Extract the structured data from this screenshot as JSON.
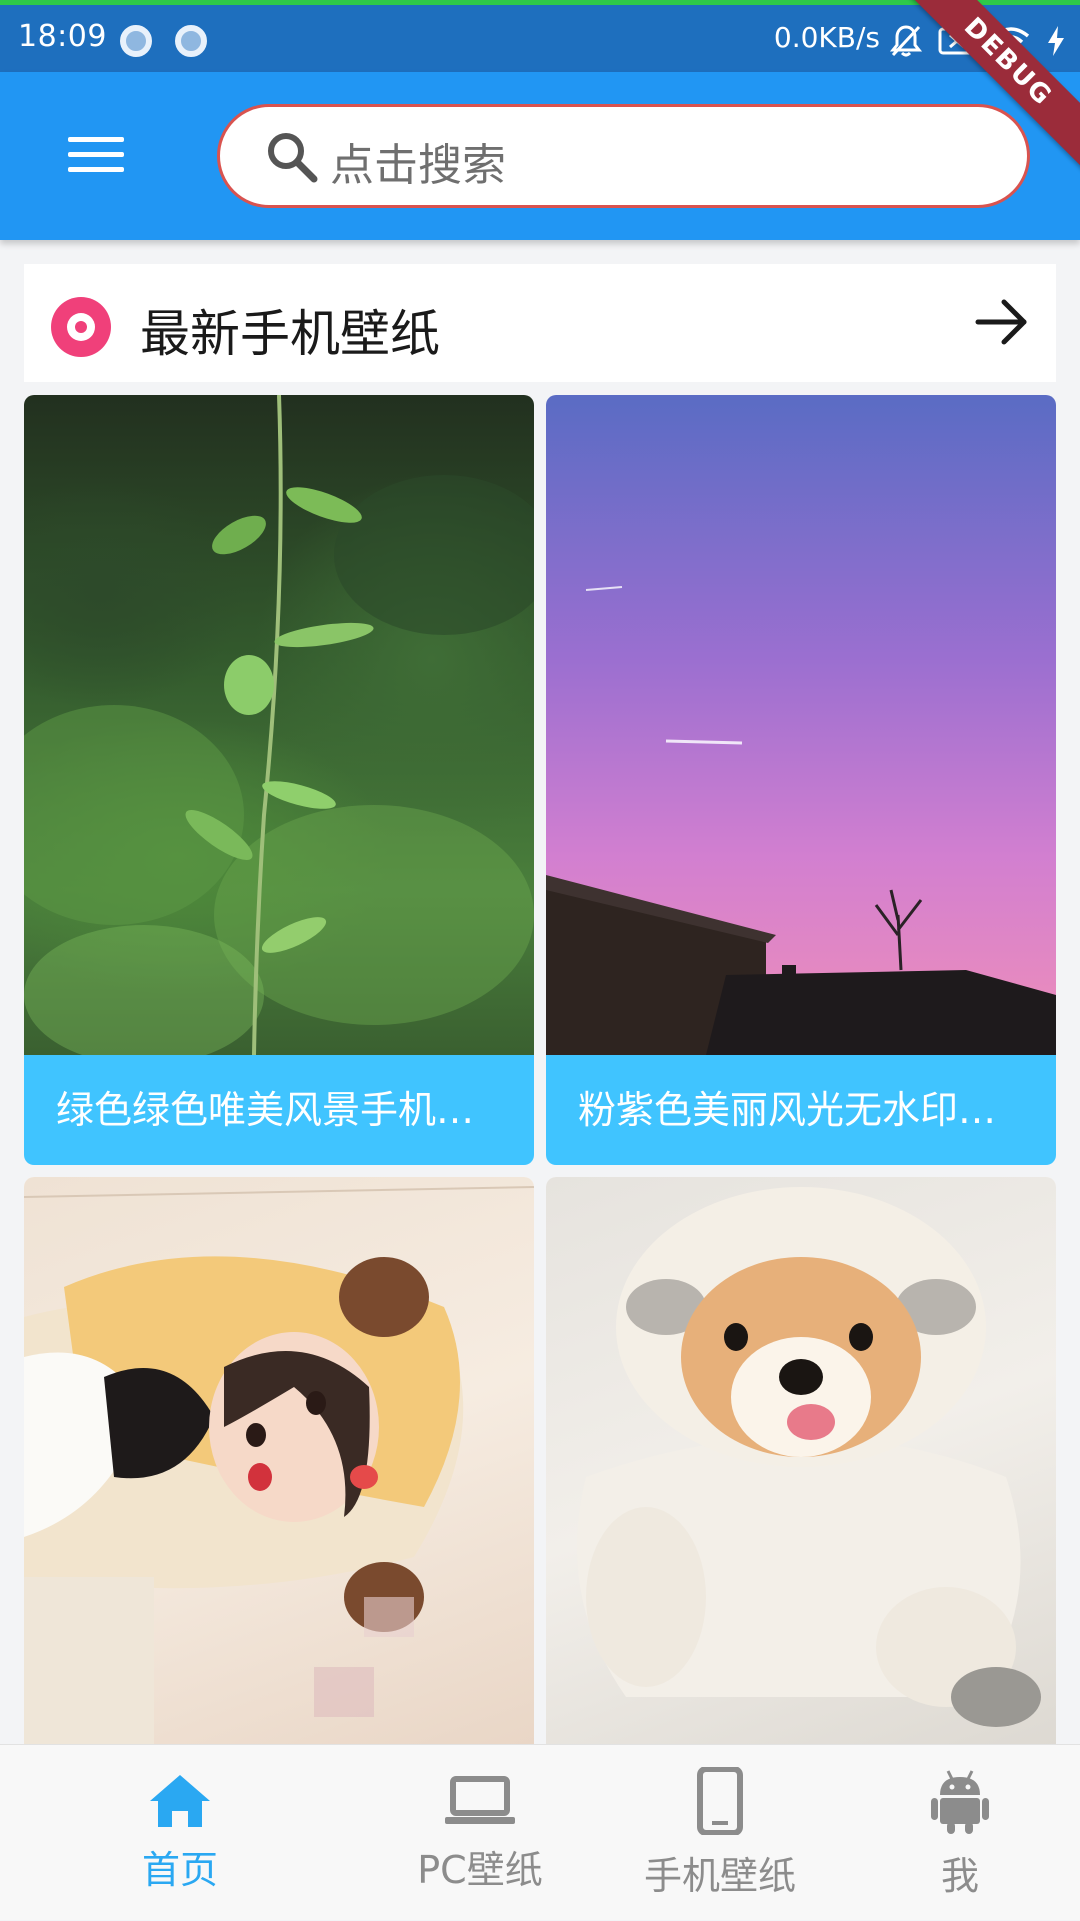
{
  "status_bar": {
    "time": "18:09",
    "network_speed": "0.0KB/s"
  },
  "debug_banner": "DEBUG",
  "search": {
    "placeholder": "点击搜索"
  },
  "section": {
    "title": "最新手机壁纸"
  },
  "cards": [
    {
      "caption": "绿色绿色唯美风景手机壁纸"
    },
    {
      "caption": "粉紫色美丽风光无水印手机壁纸"
    },
    {
      "caption": ""
    },
    {
      "caption": ""
    }
  ],
  "bottom_nav": {
    "items": [
      {
        "label": "首页",
        "icon": "home-icon",
        "active": true
      },
      {
        "label": "PC壁纸",
        "icon": "laptop-icon",
        "active": false
      },
      {
        "label": "手机壁纸",
        "icon": "phone-icon",
        "active": false
      },
      {
        "label": "我",
        "icon": "android-icon",
        "active": false
      }
    ]
  },
  "colors": {
    "status_bar": "#1e6fbe",
    "app_bar": "#2196f3",
    "search_border": "#d9534f",
    "section_icon": "#f0407a",
    "caption_bg": "#40c4ff",
    "nav_active": "#2aa8f2",
    "nav_inactive": "#8c8c8c"
  }
}
